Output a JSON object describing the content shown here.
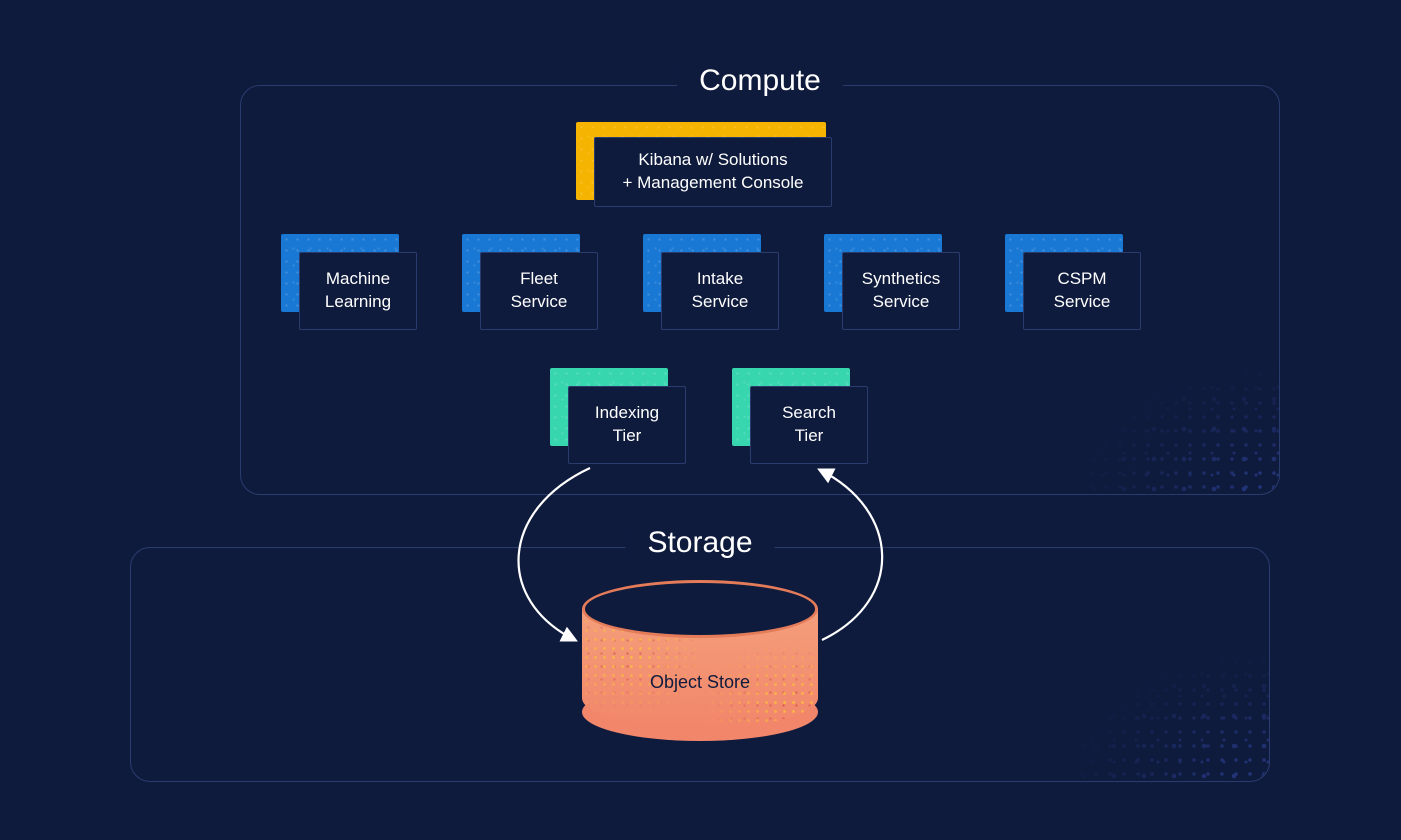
{
  "sections": {
    "compute": {
      "title": "Compute"
    },
    "storage": {
      "title": "Storage"
    }
  },
  "nodes": {
    "kibana": {
      "line1": "Kibana w/ Solutions",
      "line2": "+ Management Console"
    },
    "ml": {
      "line1": "Machine",
      "line2": "Learning"
    },
    "fleet": {
      "line1": "Fleet",
      "line2": "Service"
    },
    "intake": {
      "line1": "Intake",
      "line2": "Service"
    },
    "synthetics": {
      "line1": "Synthetics",
      "line2": "Service"
    },
    "cspm": {
      "line1": "CSPM",
      "line2": "Service"
    },
    "indexing": {
      "line1": "Indexing",
      "line2": "Tier"
    },
    "search": {
      "line1": "Search",
      "line2": "Tier"
    }
  },
  "cylinder": {
    "label": "Object Store"
  },
  "colors": {
    "bg": "#0f1b3d",
    "border": "#2a3c6e",
    "shadow_yellow": "#f5b400",
    "shadow_blue": "#1978d4",
    "shadow_teal": "#38d6ae",
    "cylinder_fill": "#f2866a",
    "cylinder_top_border": "#e47c5a"
  }
}
